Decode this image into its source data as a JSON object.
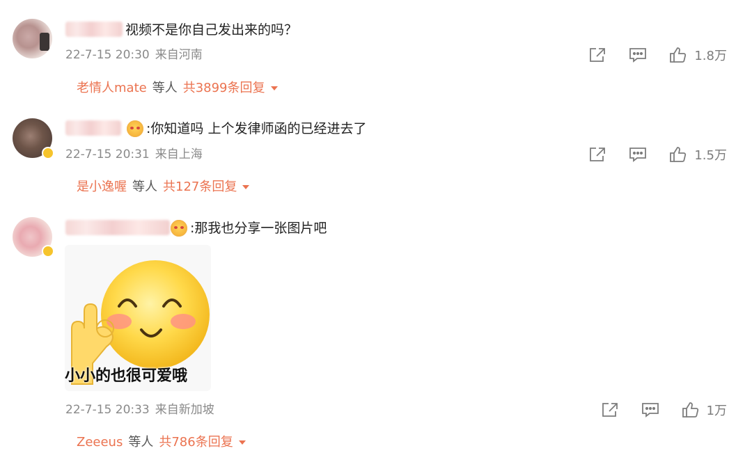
{
  "comments": [
    {
      "text": "视频不是你自己发出来的吗？",
      "time": "22-7-15 20:30",
      "location": "来自河南",
      "likes": "1.8万",
      "replies": {
        "name": "老情人mate",
        "etc": "等人",
        "total": "共3899条回复"
      }
    },
    {
      "text": ":你知道吗 上个发律师函的已经进去了",
      "time": "22-7-15 20:31",
      "location": "来自上海",
      "likes": "1.5万",
      "replies": {
        "name": "是小逸喔",
        "etc": "等人",
        "total": "共127条回复"
      }
    },
    {
      "text": ":那我也分享一张图片吧",
      "sticker_caption": "小小的也很可爱哦",
      "time": "22-7-15 20:33",
      "location": "来自新加坡",
      "likes": "1万",
      "replies": {
        "name": "Zeeeus",
        "etc": "等人",
        "total": "共786条回复"
      }
    }
  ],
  "colors": {
    "accent": "#eb7350",
    "meta": "#8a8a8a",
    "icon": "#7c7c7c"
  },
  "icons": [
    "share-icon",
    "comment-icon",
    "like-icon",
    "dropdown-caret-icon"
  ]
}
